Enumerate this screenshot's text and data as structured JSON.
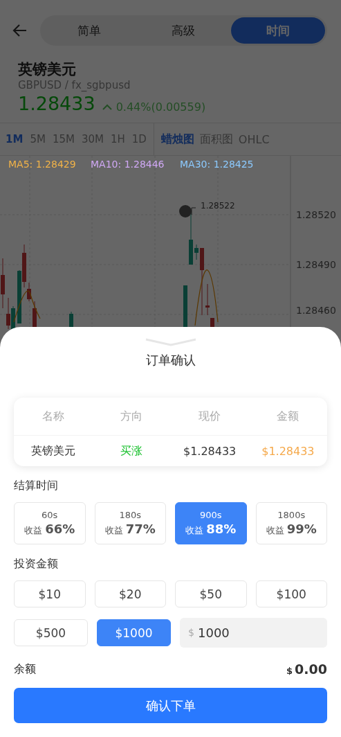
{
  "header": {
    "tabs": [
      {
        "label": "简单",
        "selected": false
      },
      {
        "label": "高级",
        "selected": false
      },
      {
        "label": "时间",
        "selected": true
      }
    ]
  },
  "instrument": {
    "name": "英镑美元",
    "symbol": "GBPUSD / fx_sgbpusd",
    "price": "1.28433",
    "change": "0.44%(0.00559)"
  },
  "intervals": [
    {
      "label": "1M",
      "selected": true
    },
    {
      "label": "5M",
      "selected": false
    },
    {
      "label": "15M",
      "selected": false
    },
    {
      "label": "30M",
      "selected": false
    },
    {
      "label": "1H",
      "selected": false
    },
    {
      "label": "1D",
      "selected": false
    }
  ],
  "chart_types": [
    {
      "label": "蜡烛图",
      "selected": true
    },
    {
      "label": "面积图",
      "selected": false
    },
    {
      "label": "OHLC",
      "selected": false
    }
  ],
  "chart": {
    "indicators": [
      {
        "label": "MA5: 1.28429",
        "color": "#f2b348"
      },
      {
        "label": "MA10: 1.28446",
        "color": "#d0a8f5"
      },
      {
        "label": "MA30: 1.28425",
        "color": "#8ccaff"
      }
    ],
    "high_label": "1.28522",
    "y_labels": [
      "1.28520",
      "1.28490",
      "1.28460"
    ]
  },
  "order": {
    "title": "订单确认",
    "columns": [
      "名称",
      "方向",
      "现价",
      "金额"
    ],
    "row": {
      "name": "英镑美元",
      "direction": "买涨",
      "price": "$1.28433",
      "amount": "$1.28433"
    }
  },
  "settlement": {
    "label": "结算时间",
    "options": [
      {
        "time": "60s",
        "profit_label": "收益",
        "profit": "66%",
        "selected": false
      },
      {
        "time": "180s",
        "profit_label": "收益",
        "profit": "77%",
        "selected": false
      },
      {
        "time": "900s",
        "profit_label": "收益",
        "profit": "88%",
        "selected": true
      },
      {
        "time": "1800s",
        "profit_label": "收益",
        "profit": "99%",
        "selected": false
      }
    ]
  },
  "investment": {
    "label": "投资金额",
    "amounts": [
      {
        "label": "$10",
        "selected": false
      },
      {
        "label": "$20",
        "selected": false
      },
      {
        "label": "$50",
        "selected": false
      },
      {
        "label": "$100",
        "selected": false
      },
      {
        "label": "$500",
        "selected": false
      },
      {
        "label": "$1000",
        "selected": true
      }
    ],
    "input": {
      "currency": "$",
      "value": "1000"
    }
  },
  "balance": {
    "label": "余额",
    "currency": "$",
    "value": "0.00"
  },
  "confirm_button": "确认下单"
}
